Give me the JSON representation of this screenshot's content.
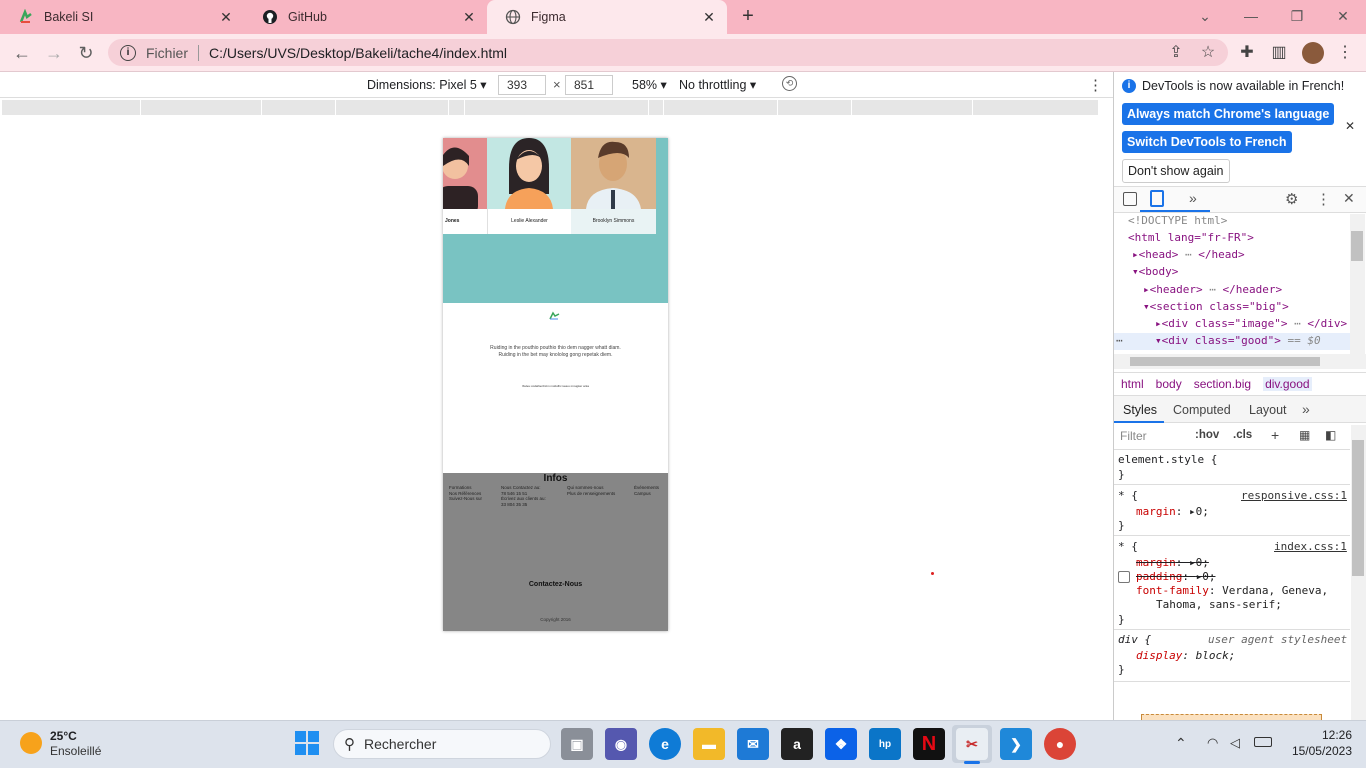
{
  "browser": {
    "tabs": [
      {
        "title": "Bakeli SI",
        "active": false
      },
      {
        "title": "GitHub",
        "active": false
      },
      {
        "title": "Figma",
        "active": true
      }
    ],
    "new_tab_label": "+",
    "address": {
      "scheme_label": "Fichier",
      "url": "C:/Users/UVS/Desktop/Bakeli/tache4/index.html"
    }
  },
  "device_toolbar": {
    "dimensions_label": "Dimensions: Pixel 5",
    "width": "393",
    "times": "×",
    "height": "851",
    "zoom": "58%",
    "throttling": "No throttling"
  },
  "page": {
    "team": [
      "Jones",
      "Leslie Alexander",
      "Brooklyn Simmons"
    ],
    "text_line1": "Ruiding in the pouthio pouthio thio dem nagger whatt diam.",
    "text_line2": "Ruiding in the bet may knololog gong repetak diem.",
    "small_text": "Ibuleu codahienhcim moltulhc iauuu mnugker anta",
    "footer": {
      "title": "Infos",
      "col1": [
        "Formations",
        "Nos Références",
        "Suivez-Nous sur"
      ],
      "col2": [
        "Nous Contactez au:",
        "78 546 15 51",
        "Écrivez aux clients au:",
        "33 804 35 35"
      ],
      "col3": [
        "Qui sommes-nous",
        "Plus de renseignements"
      ],
      "col4": [
        "Événements",
        "Campus"
      ],
      "contact": "Contactez-Nous",
      "copyright": "Copyright 2016"
    }
  },
  "devtools": {
    "banner_text": "DevTools is now available in French!",
    "btn_match": "Always match Chrome's language",
    "btn_switch": "Switch DevTools to French",
    "btn_dont": "Don't show again",
    "dom": {
      "doctype": "<!DOCTYPE html>",
      "html": "<html lang=\"fr-FR\">",
      "head": "<head>",
      "head_close": "</head>",
      "body": "<body>",
      "header": "<header>",
      "header_close": "</header>",
      "section": "<section class=\"big\">",
      "div_image": "<div class=\"image\">",
      "div_close": "</div>",
      "div_good": "<div class=\"good\">",
      "eq": "== $0"
    },
    "breadcrumbs": [
      "html",
      "body",
      "section.big",
      "div.good"
    ],
    "panel_tabs": [
      "Styles",
      "Computed",
      "Layout"
    ],
    "filter_placeholder": "Filter",
    "hov": ":hov",
    "cls": ".cls",
    "rules": {
      "element_style": "element.style {",
      "close": "}",
      "star": "* {",
      "responsive_src": "responsive.css:1",
      "index_src": "index.css:1",
      "margin": "margin",
      "zero": "0;",
      "padding": "padding",
      "font_family": "font-family",
      "font_val1": "Verdana, Geneva,",
      "font_val2": "Tahoma, sans-serif;",
      "div_sel": "div {",
      "ua": "user agent stylesheet",
      "display": "display",
      "block": "block;"
    }
  },
  "taskbar": {
    "temp": "25°C",
    "weather": "Ensoleillé",
    "search_placeholder": "Rechercher",
    "time": "12:26",
    "date": "15/05/2023"
  },
  "colors": {
    "tabstrip": "#f8b6c3",
    "teal": "#79c3c2",
    "footer_gray": "#868686",
    "accent_blue": "#1a73e8"
  }
}
